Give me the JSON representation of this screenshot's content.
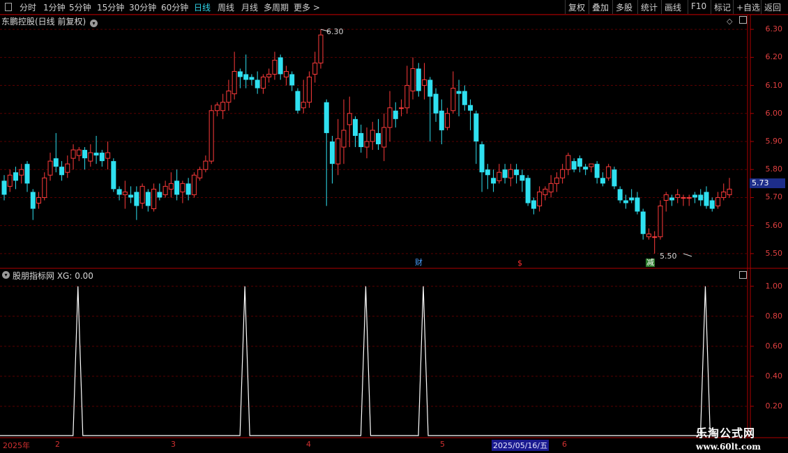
{
  "toolbar": {
    "left_items": [
      "分时",
      "1分钟",
      "5分钟",
      "15分钟",
      "30分钟",
      "60分钟",
      "日线",
      "周线",
      "月线",
      "多周期",
      "更多 >"
    ],
    "active_item": "日线",
    "right_items": [
      "复权",
      "叠加",
      "多股",
      "统计",
      "画线",
      "F10",
      "标记",
      "+自选",
      "返回"
    ]
  },
  "main_chart": {
    "title": "东鹏控股(日线 前复权)",
    "y_ticks": [
      "6.30",
      "6.20",
      "6.10",
      "6.00",
      "5.90",
      "5.80",
      "5.70",
      "5.60",
      "5.50"
    ],
    "current_price": "5.73",
    "high_marker": "6.30",
    "low_marker": "5.50",
    "events": [
      {
        "label": "财",
        "color": "#4aa0ff",
        "bg": "#000"
      },
      {
        "label": "$",
        "color": "#ff3030",
        "bg": "#000"
      },
      {
        "label": "减",
        "color": "#fff",
        "bg": "#2a7a2a"
      }
    ]
  },
  "indicator": {
    "title": "股朋指标网  XG: 0.00",
    "y_ticks": [
      "1.00",
      "0.80",
      "0.60",
      "0.40",
      "0.20"
    ]
  },
  "date_axis": {
    "labels": [
      "2025年",
      "2",
      "3",
      "4",
      "5",
      "6"
    ],
    "highlight": "2025/05/16/五"
  },
  "watermark": {
    "line1": "乐淘公式网",
    "line2": "www.60lt.com"
  },
  "colors": {
    "up": "#ff3b3b",
    "down": "#2fe0f0",
    "grid": "#5a0000",
    "axis": "#b00000"
  },
  "chart_data": {
    "type": "candlestick",
    "ylim": [
      5.45,
      6.35
    ],
    "candles": [
      [
        5.76,
        5.71,
        5.78,
        5.69
      ],
      [
        5.74,
        5.78,
        5.8,
        5.72
      ],
      [
        5.79,
        5.76,
        5.81,
        5.73
      ],
      [
        5.78,
        5.8,
        5.82,
        5.75
      ],
      [
        5.82,
        5.75,
        5.83,
        5.72
      ],
      [
        5.72,
        5.66,
        5.73,
        5.62
      ],
      [
        5.68,
        5.7,
        5.72,
        5.66
      ],
      [
        5.7,
        5.77,
        5.79,
        5.69
      ],
      [
        5.78,
        5.83,
        5.86,
        5.76
      ],
      [
        5.84,
        5.81,
        5.93,
        5.79
      ],
      [
        5.81,
        5.78,
        5.83,
        5.76
      ],
      [
        5.79,
        5.82,
        5.85,
        5.77
      ],
      [
        5.84,
        5.87,
        5.89,
        5.8
      ],
      [
        5.85,
        5.87,
        5.88,
        5.83
      ],
      [
        5.87,
        5.84,
        5.88,
        5.8
      ],
      [
        5.83,
        5.86,
        5.89,
        5.81
      ],
      [
        5.86,
        5.85,
        5.92,
        5.82
      ],
      [
        5.86,
        5.83,
        5.87,
        5.81
      ],
      [
        5.84,
        5.86,
        5.9,
        5.8
      ],
      [
        5.83,
        5.73,
        5.84,
        5.72
      ],
      [
        5.73,
        5.71,
        5.74,
        5.69
      ],
      [
        5.71,
        5.72,
        5.76,
        5.66
      ],
      [
        5.71,
        5.7,
        5.74,
        5.68
      ],
      [
        5.72,
        5.67,
        5.74,
        5.62
      ],
      [
        5.68,
        5.74,
        5.75,
        5.66
      ],
      [
        5.72,
        5.67,
        5.73,
        5.65
      ],
      [
        5.66,
        5.73,
        5.75,
        5.65
      ],
      [
        5.72,
        5.7,
        5.75,
        5.69
      ],
      [
        5.71,
        5.74,
        5.76,
        5.7
      ],
      [
        5.73,
        5.75,
        5.79,
        5.7
      ],
      [
        5.76,
        5.71,
        5.8,
        5.69
      ],
      [
        5.72,
        5.75,
        5.76,
        5.68
      ],
      [
        5.75,
        5.71,
        5.77,
        5.69
      ],
      [
        5.71,
        5.78,
        5.79,
        5.7
      ],
      [
        5.77,
        5.8,
        5.81,
        5.76
      ],
      [
        5.8,
        5.83,
        5.85,
        5.79
      ],
      [
        5.83,
        6.01,
        6.03,
        5.82
      ],
      [
        6.01,
        6.03,
        6.04,
        5.99
      ],
      [
        6.01,
        6.04,
        6.07,
        5.98
      ],
      [
        6.04,
        6.08,
        6.12,
        6.01
      ],
      [
        6.07,
        6.15,
        6.22,
        6.05
      ],
      [
        6.15,
        6.13,
        6.16,
        6.09
      ],
      [
        6.14,
        6.12,
        6.21,
        6.09
      ],
      [
        6.13,
        6.12,
        6.14,
        6.1
      ],
      [
        6.12,
        6.09,
        6.15,
        6.07
      ],
      [
        6.09,
        6.13,
        6.14,
        6.07
      ],
      [
        6.13,
        6.14,
        6.16,
        6.11
      ],
      [
        6.14,
        6.19,
        6.22,
        6.12
      ],
      [
        6.2,
        6.14,
        6.21,
        6.12
      ],
      [
        6.13,
        6.15,
        6.17,
        6.1
      ],
      [
        6.14,
        6.1,
        6.15,
        6.08
      ],
      [
        6.08,
        6.01,
        6.09,
        6.0
      ],
      [
        6.02,
        6.04,
        6.12,
        6.0
      ],
      [
        6.04,
        6.13,
        6.15,
        6.02
      ],
      [
        6.14,
        6.18,
        6.22,
        6.11
      ],
      [
        6.18,
        6.28,
        6.3,
        6.16
      ],
      [
        6.04,
        5.93,
        6.05,
        5.67
      ],
      [
        5.9,
        5.82,
        5.92,
        5.75
      ],
      [
        5.82,
        5.91,
        5.98,
        5.78
      ],
      [
        5.88,
        5.94,
        6.05,
        5.82
      ],
      [
        5.96,
        6.0,
        6.06,
        5.88
      ],
      [
        5.98,
        5.92,
        5.99,
        5.88
      ],
      [
        5.93,
        5.88,
        5.96,
        5.86
      ],
      [
        5.88,
        5.9,
        5.95,
        5.84
      ],
      [
        5.9,
        5.94,
        5.97,
        5.87
      ],
      [
        5.93,
        5.89,
        5.98,
        5.87
      ],
      [
        5.88,
        5.95,
        6.0,
        5.83
      ],
      [
        5.95,
        6.02,
        6.08,
        5.9
      ],
      [
        6.01,
        5.98,
        6.04,
        5.95
      ],
      [
        6.02,
        6.02,
        6.05,
        5.99
      ],
      [
        6.02,
        6.1,
        6.17,
        6.0
      ],
      [
        6.08,
        6.16,
        6.2,
        6.05
      ],
      [
        6.16,
        6.08,
        6.18,
        6.06
      ],
      [
        6.1,
        6.12,
        6.18,
        6.05
      ],
      [
        6.12,
        6.06,
        6.13,
        5.9
      ],
      [
        6.07,
        6.0,
        6.09,
        5.97
      ],
      [
        6.01,
        5.94,
        6.05,
        5.89
      ],
      [
        5.95,
        6.0,
        6.02,
        5.94
      ],
      [
        6.01,
        6.09,
        6.15,
        6.0
      ],
      [
        6.08,
        6.07,
        6.12,
        5.99
      ],
      [
        6.08,
        6.03,
        6.1,
        6.01
      ],
      [
        6.03,
        6.01,
        6.05,
        5.94
      ],
      [
        6.0,
        5.9,
        6.01,
        5.82
      ],
      [
        5.89,
        5.79,
        5.9,
        5.72
      ],
      [
        5.8,
        5.78,
        5.82,
        5.73
      ],
      [
        5.77,
        5.75,
        5.8,
        5.72
      ],
      [
        5.76,
        5.79,
        5.82,
        5.75
      ],
      [
        5.8,
        5.77,
        5.82,
        5.75
      ],
      [
        5.77,
        5.8,
        5.82,
        5.74
      ],
      [
        5.8,
        5.78,
        5.82,
        5.75
      ],
      [
        5.78,
        5.76,
        5.8,
        5.72
      ],
      [
        5.77,
        5.68,
        5.78,
        5.67
      ],
      [
        5.69,
        5.66,
        5.7,
        5.64
      ],
      [
        5.67,
        5.72,
        5.74,
        5.65
      ],
      [
        5.71,
        5.73,
        5.74,
        5.69
      ],
      [
        5.72,
        5.75,
        5.78,
        5.7
      ],
      [
        5.75,
        5.77,
        5.79,
        5.72
      ],
      [
        5.77,
        5.8,
        5.82,
        5.75
      ],
      [
        5.8,
        5.85,
        5.86,
        5.78
      ],
      [
        5.83,
        5.8,
        5.84,
        5.79
      ],
      [
        5.84,
        5.81,
        5.85,
        5.79
      ],
      [
        5.81,
        5.8,
        5.82,
        5.78
      ],
      [
        5.81,
        5.82,
        5.82,
        5.79
      ],
      [
        5.82,
        5.77,
        5.83,
        5.75
      ],
      [
        5.77,
        5.75,
        5.79,
        5.74
      ],
      [
        5.77,
        5.81,
        5.82,
        5.76
      ],
      [
        5.8,
        5.74,
        5.81,
        5.73
      ],
      [
        5.73,
        5.69,
        5.74,
        5.68
      ],
      [
        5.69,
        5.68,
        5.71,
        5.66
      ],
      [
        5.7,
        5.69,
        5.73,
        5.68
      ],
      [
        5.7,
        5.65,
        5.72,
        5.64
      ],
      [
        5.65,
        5.57,
        5.66,
        5.55
      ],
      [
        5.56,
        5.57,
        5.59,
        5.55
      ],
      [
        5.56,
        5.56,
        5.58,
        5.5
      ],
      [
        5.56,
        5.67,
        5.69,
        5.55
      ],
      [
        5.69,
        5.71,
        5.72,
        5.65
      ],
      [
        5.7,
        5.69,
        5.71,
        5.67
      ],
      [
        5.7,
        5.71,
        5.73,
        5.68
      ],
      [
        5.7,
        5.7,
        5.71,
        5.67
      ],
      [
        5.7,
        5.7,
        5.71,
        5.67
      ],
      [
        5.71,
        5.7,
        5.72,
        5.68
      ],
      [
        5.71,
        5.69,
        5.73,
        5.67
      ],
      [
        5.72,
        5.67,
        5.74,
        5.66
      ],
      [
        5.69,
        5.66,
        5.7,
        5.65
      ],
      [
        5.67,
        5.7,
        5.72,
        5.66
      ],
      [
        5.7,
        5.72,
        5.75,
        5.69
      ],
      [
        5.71,
        5.73,
        5.77,
        5.7
      ]
    ],
    "indicator_series": {
      "name": "XG",
      "peaks_at": [
        7,
        36,
        57,
        67,
        116
      ],
      "ylim": [
        0,
        1.05
      ]
    }
  }
}
